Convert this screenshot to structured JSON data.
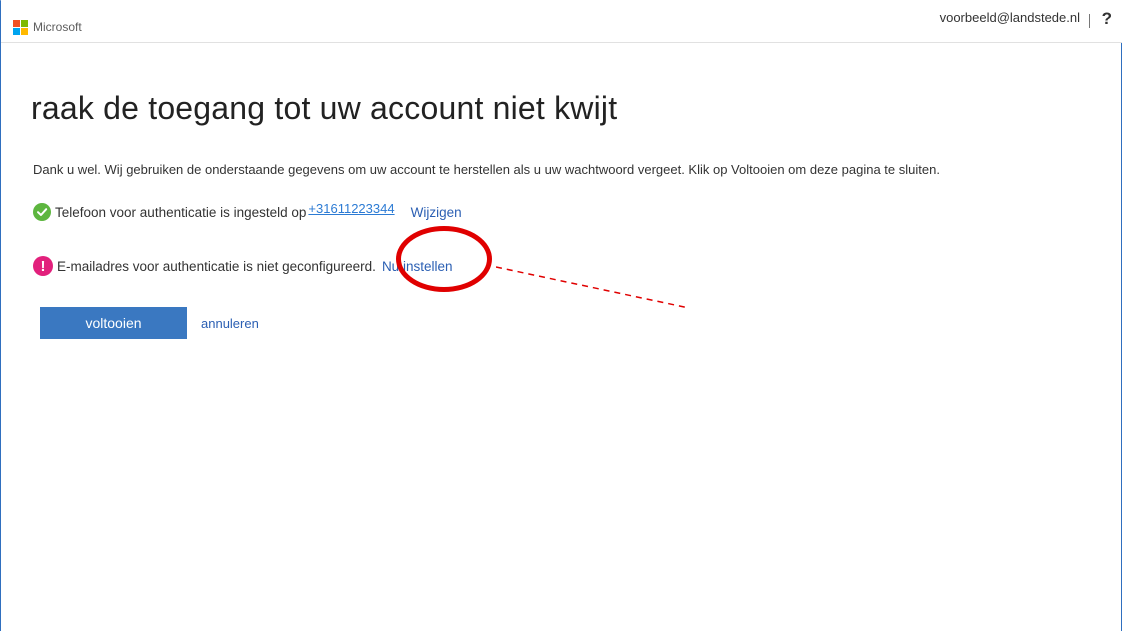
{
  "header": {
    "brand": "Microsoft",
    "user_email": "voorbeeld@landstede.nl",
    "help_label": "?"
  },
  "colors": {
    "ms_red": "#f25022",
    "ms_green": "#7fba00",
    "ms_blue": "#00a4ef",
    "ms_yellow": "#ffb900",
    "primary": "#3a78c1",
    "success": "#5db63f",
    "warning": "#e2207c",
    "annotation": "#e00000"
  },
  "main": {
    "title": "raak de toegang tot uw account niet kwijt",
    "intro": "Dank u wel. Wij gebruiken de onderstaande gegevens om uw account te herstellen als u uw wachtwoord vergeet. Klik op Voltooien om deze pagina te sluiten.",
    "phone": {
      "icon": "checkmark-icon",
      "text": "Telefoon voor authenticatie is ingesteld op",
      "number": "+31611223344",
      "action": "Wijzigen"
    },
    "email": {
      "icon": "exclamation-icon",
      "text": "E-mailadres voor authenticatie is niet geconfigureerd.",
      "action": "Nu instellen"
    },
    "buttons": {
      "finish": "voltooien",
      "cancel": "annuleren"
    }
  }
}
